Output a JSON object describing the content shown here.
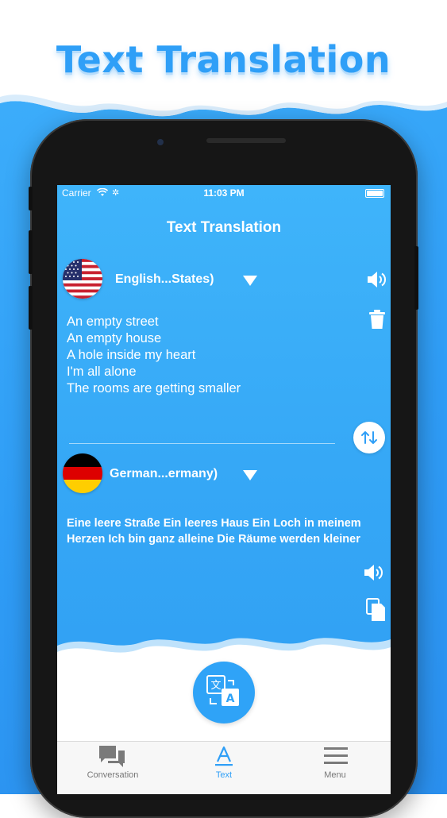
{
  "promo": {
    "title": "Text Translation"
  },
  "status": {
    "carrier": "Carrier",
    "time": "11:03 PM"
  },
  "app": {
    "title": "Text Translation"
  },
  "source": {
    "language": "English...States)",
    "lines": [
      "An empty street",
      "An empty house",
      "A hole inside my heart",
      "I'm all alone",
      "The rooms are getting smaller"
    ]
  },
  "target": {
    "language": "German...ermany)",
    "text": "Eine leere Straße Ein leeres Haus Ein Loch in meinem Herzen Ich bin ganz alleine Die Räume werden kleiner"
  },
  "tabs": [
    {
      "label": "Conversation",
      "icon": "chat-bubbles-icon",
      "active": false
    },
    {
      "label": "Text",
      "icon": "text-a-icon",
      "active": true
    },
    {
      "label": "Menu",
      "icon": "hamburger-menu-icon",
      "active": false
    }
  ],
  "colors": {
    "brand": "#2f9ff7",
    "screen_bg": "#35a7f6",
    "text_white": "#ffffff",
    "tab_inactive": "#777777"
  }
}
